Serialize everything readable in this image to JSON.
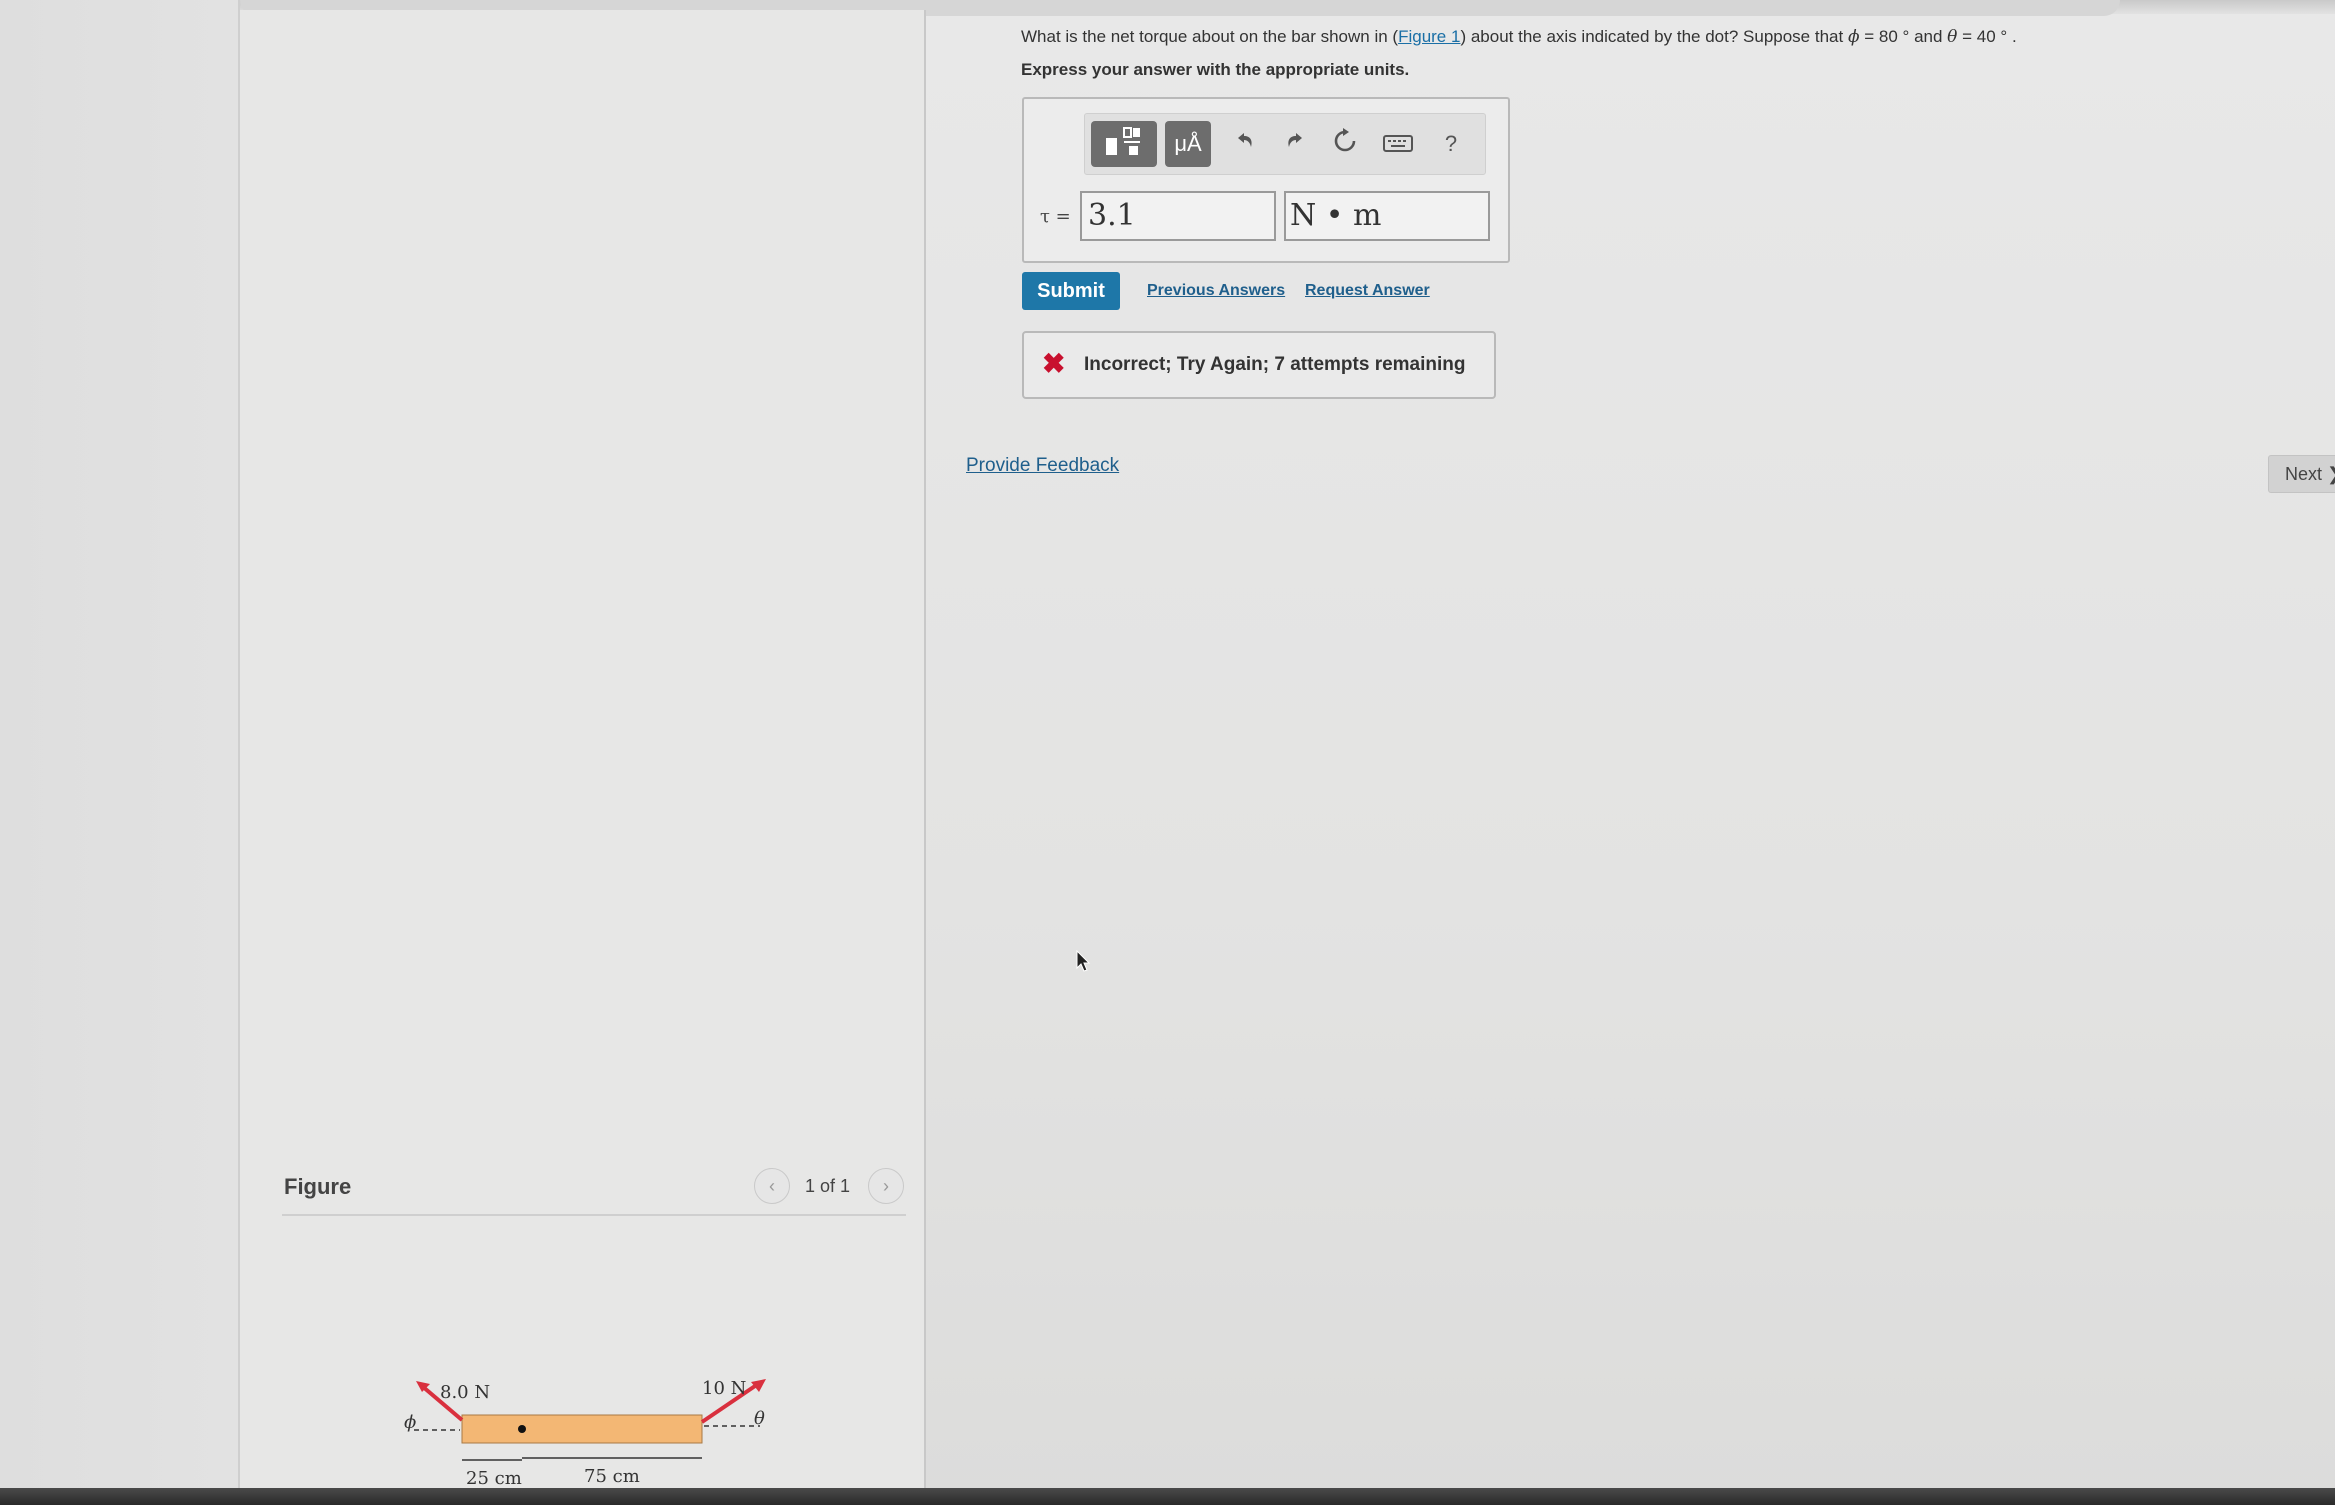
{
  "question": {
    "text_before": "What is the net torque about on the bar shown in (",
    "figure_link": "Figure 1",
    "text_middle": ") about the axis indicated by the dot? Suppose that ",
    "phi_symbol": "ϕ",
    "phi_value": " = 80 ° ",
    "and_text": "and ",
    "theta_symbol": "θ",
    "theta_value": " = 40 °",
    "period": " ."
  },
  "instruction": "Express your answer with the appropriate units.",
  "toolbar": {
    "templates_icon": "templates-icon",
    "units_label": "μÅ",
    "undo_icon": "undo-icon",
    "redo_icon": "redo-icon",
    "reset_icon": "reset-icon",
    "keyboard_icon": "keyboard-icon",
    "help_label": "?"
  },
  "answer": {
    "label": "τ =",
    "value": "3.1",
    "units": "N • m"
  },
  "actions": {
    "submit": "Submit",
    "previous_answers": "Previous Answers",
    "request_answer": "Request Answer"
  },
  "feedback": {
    "icon": "✖",
    "message": "Incorrect; Try Again; 7 attempts remaining"
  },
  "provide_feedback": "Provide Feedback",
  "next": "Next ❯",
  "figure": {
    "title": "Figure",
    "prev": "‹",
    "next": "›",
    "count": "1 of 1",
    "left_force": "8.0 N",
    "right_force": "10 N",
    "phi": "ϕ",
    "theta": "θ",
    "dim_left": "25 cm",
    "dim_right": "75 cm",
    "bar_color": "#f3b774",
    "arrow_color": "#d9303e"
  }
}
